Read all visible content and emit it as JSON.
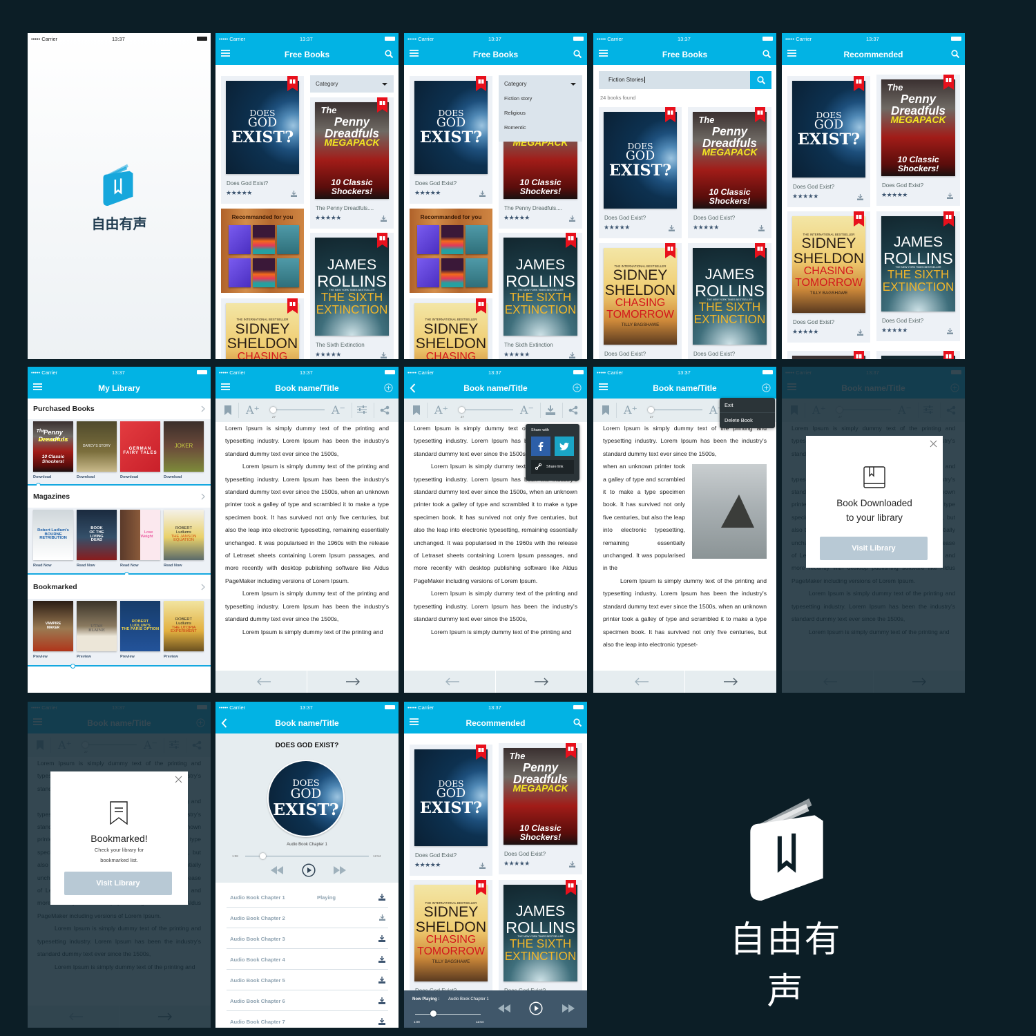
{
  "app": {
    "name": "自由有声"
  },
  "status": {
    "carrier": "••••• Carrier",
    "time": "13:37"
  },
  "titles": {
    "free_books": "Free Books",
    "recommended": "Recommended",
    "my_library": "My Library",
    "book": "Book name/Title"
  },
  "labels": {
    "stars": "★★★★★",
    "recommended_for_you": "Recommanded for you",
    "books_found": "24 books found"
  },
  "category": {
    "label": "Category",
    "options": [
      "Fiction story",
      "Religious",
      "Romentic"
    ]
  },
  "search": {
    "value": "Fiction Stories"
  },
  "book_titles": {
    "god": "Does God Exist?",
    "penny": "The Penny Dreadfuls....",
    "rollins": "The Sixth Extinction"
  },
  "covers": {
    "god": [
      "DOES",
      "GOD",
      "EXIST?"
    ],
    "penny": [
      "The",
      "Penny Dreadfuls",
      "MEGAPACK",
      "10 Classic Shockers!"
    ],
    "sidney": [
      "THE INTERNATIONAL BESTSELLER",
      "SIDNEY",
      "SHELDON",
      "CHASING",
      "TOMORROW",
      "TILLY BAGSHAWE"
    ],
    "rollins": [
      "JAMES",
      "ROLLINS",
      "THE NEW YORK TIMES BESTSELLER",
      "THE SIXTH",
      "EXTINCTION"
    ],
    "darcy": [
      "DARCY'S STORY"
    ],
    "german": [
      "GERMAN",
      "FAIRY TALES"
    ],
    "joker": [
      "JOKER"
    ],
    "bourne": [
      "Robert Ludlum's",
      "BOURNE",
      "RETRIBUTION"
    ],
    "living": [
      "BOOK",
      "OF THE",
      "LIVING",
      "DEAD"
    ],
    "lose": [
      "Lose",
      "Weight"
    ],
    "janson": [
      "ROBERT",
      "Ludlums",
      "THE JANSON",
      "EQUATION"
    ],
    "vampire": [
      "VAMPIRE",
      "MAKER"
    ],
    "utah": [
      "UTAH",
      "BLAINE"
    ],
    "paris": [
      "ROBERT",
      "LUDLUM'S",
      "THE PARIS OPTION"
    ],
    "utopia": [
      "ROBERT",
      "Ludlums",
      "THE UTOPIA",
      "EXPERIMENT"
    ]
  },
  "library": {
    "sections": [
      {
        "title": "Purchased Books",
        "action": "Download",
        "books": [
          "penny",
          "darcy",
          "german",
          "joker"
        ]
      },
      {
        "title": "Magazines",
        "action": "Read Now",
        "books": [
          "bourne",
          "living",
          "lose",
          "janson"
        ]
      },
      {
        "title": "Bookmarked",
        "action": "Preview",
        "books": [
          "vampire",
          "utah",
          "paris",
          "utopia"
        ]
      }
    ]
  },
  "reader": {
    "toolbar": {
      "increase": "A⁺",
      "decrease": "A⁻",
      "font_size": "27"
    },
    "paragraphs": [
      "Lorem Ipsum is simply dummy text of the printing and typesetting industry. Lorem Ipsum has been the industry's standard dummy text ever since the 1500s,",
      "Lorem Ipsum is simply dummy text of the printing and typesetting industry. Lorem Ipsum has been the industry's standard dummy text ever since the 1500s, when an unknown printer took a galley of type and scrambled it to make a type specimen book. It has survived not only five centuries, but also the leap into electronic typesetting, remaining essentially unchanged. It was popularised in the 1960s with the release of Letraset sheets containing Lorem Ipsum passages, and more recently with desktop publishing software like Aldus PageMaker including versions of Lorem Ipsum.",
      "Lorem Ipsum is simply dummy text of the printing and typesetting industry. Lorem Ipsum has been the industry's standard dummy text ever since the 1500s,",
      "Lorem Ipsum is simply dummy text of the printing and"
    ],
    "image_page": [
      "Lorem Ipsum is simply dummy text of the printing and typesetting industry. Lorem Ipsum has been the industry's standard dummy text ever since the 1500s,",
      "when an unknown printer took a galley of type and scrambled it to make a type specimen book. It has survived not only five centuries, but also the leap into electronic typesetting, remaining essentially unchanged. It was popularised in the",
      "Lorem Ipsum is simply dummy text of the printing and typesetting industry. Lorem Ipsum has been the industry's standard dummy text ever since the 1500s, when an unknown printer took a galley of type and scrambled it to make a type specimen book. It has survived not only five centuries, but also the leap into electronic typeset-"
    ],
    "share": {
      "title": "Share with",
      "link": "Share link"
    },
    "menu": [
      "Exit",
      "Delete Book"
    ]
  },
  "modals": {
    "downloaded": {
      "line1": "Book Downloaded",
      "line2": "to your library",
      "button": "Visit Library"
    },
    "bookmarked": {
      "title": "Bookmarked!",
      "line1": "Check your library for",
      "line2": "bookmarked list.",
      "button": "Visit Library"
    }
  },
  "audio": {
    "book_title": "DOES GOD EXIST?",
    "current_chapter": "Audio Book Chapter 1",
    "elapsed": "1:08",
    "duration": "12:54",
    "progress": 0.09,
    "playing_label": "Playing",
    "now_playing_label": "Now Playing :",
    "chapters": [
      "Audio Book Chapter 1",
      "Audio Book Chapter 2",
      "Audio Book Chapter 3",
      "Audio Book Chapter 4",
      "Audio Book Chapter 5",
      "Audio Book Chapter 6",
      "Audio Book Chapter 7"
    ]
  },
  "colors": {
    "brand": "#02b3e4",
    "ribbon": "#e8101c",
    "background": "#0c1e26"
  }
}
